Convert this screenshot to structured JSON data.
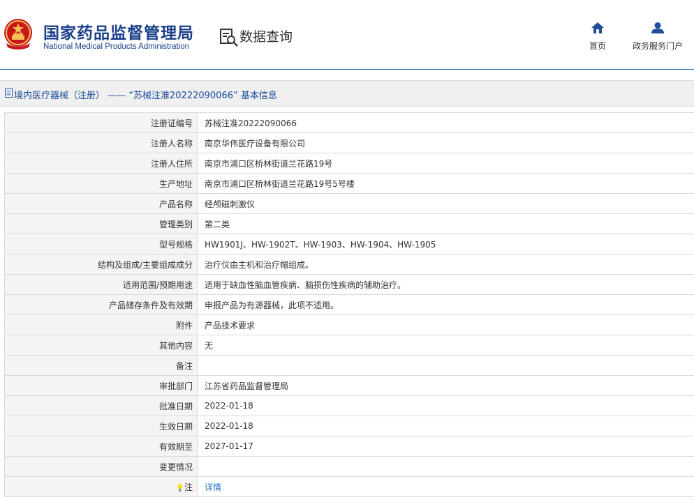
{
  "header": {
    "title_cn": "国家药品监督管理局",
    "title_en": "National Medical Products Administration",
    "data_query": "数据查询",
    "nav": [
      {
        "label": "首页",
        "icon": "home-icon"
      },
      {
        "label": "政务服务门户",
        "icon": "user-icon"
      }
    ]
  },
  "breadcrumb": {
    "text": "境内医疗器械（注册） —— “苏械注准20222090066” 基本信息"
  },
  "rows": [
    {
      "label": "注册证编号",
      "value": "苏械注准20222090066"
    },
    {
      "label": "注册人名称",
      "value": "南京华伟医疗设备有限公司"
    },
    {
      "label": "注册人住所",
      "value": "南京市浦口区桥林街道兰花路19号"
    },
    {
      "label": "生产地址",
      "value": "南京市浦口区桥林街道兰花路19号5号楼"
    },
    {
      "label": "产品名称",
      "value": "经颅磁刺激仪"
    },
    {
      "label": "管理类别",
      "value": "第二类"
    },
    {
      "label": "型号规格",
      "value": "HW1901J、HW-1902T、HW-1903、HW-1904、HW-1905"
    },
    {
      "label": "结构及组成/主要组成成分",
      "value": "治疗仪由主机和治疗帽组成。"
    },
    {
      "label": "适用范围/预期用途",
      "value": "适用于缺血性脑血管疾病、脑损伤性疾病的辅助治疗。"
    },
    {
      "label": "产品储存条件及有效期",
      "value": "申报产品为有源器械，此项不适用。"
    },
    {
      "label": "附件",
      "value": "产品技术要求"
    },
    {
      "label": "其他内容",
      "value": "无"
    },
    {
      "label": "备注",
      "value": ""
    },
    {
      "label": "审批部门",
      "value": "江苏省药品监督管理局"
    },
    {
      "label": "批准日期",
      "value": "2022-01-18"
    },
    {
      "label": "生效日期",
      "value": "2022-01-18"
    },
    {
      "label": "有效期至",
      "value": "2027-01-17"
    },
    {
      "label": "变更情况",
      "value": ""
    },
    {
      "label": "注",
      "value": "详情",
      "link": true,
      "icon": "bulb-icon"
    }
  ],
  "colors": {
    "brand": "#1a3f8a",
    "link": "#1b6fc8",
    "divider": "#2f6fba"
  }
}
